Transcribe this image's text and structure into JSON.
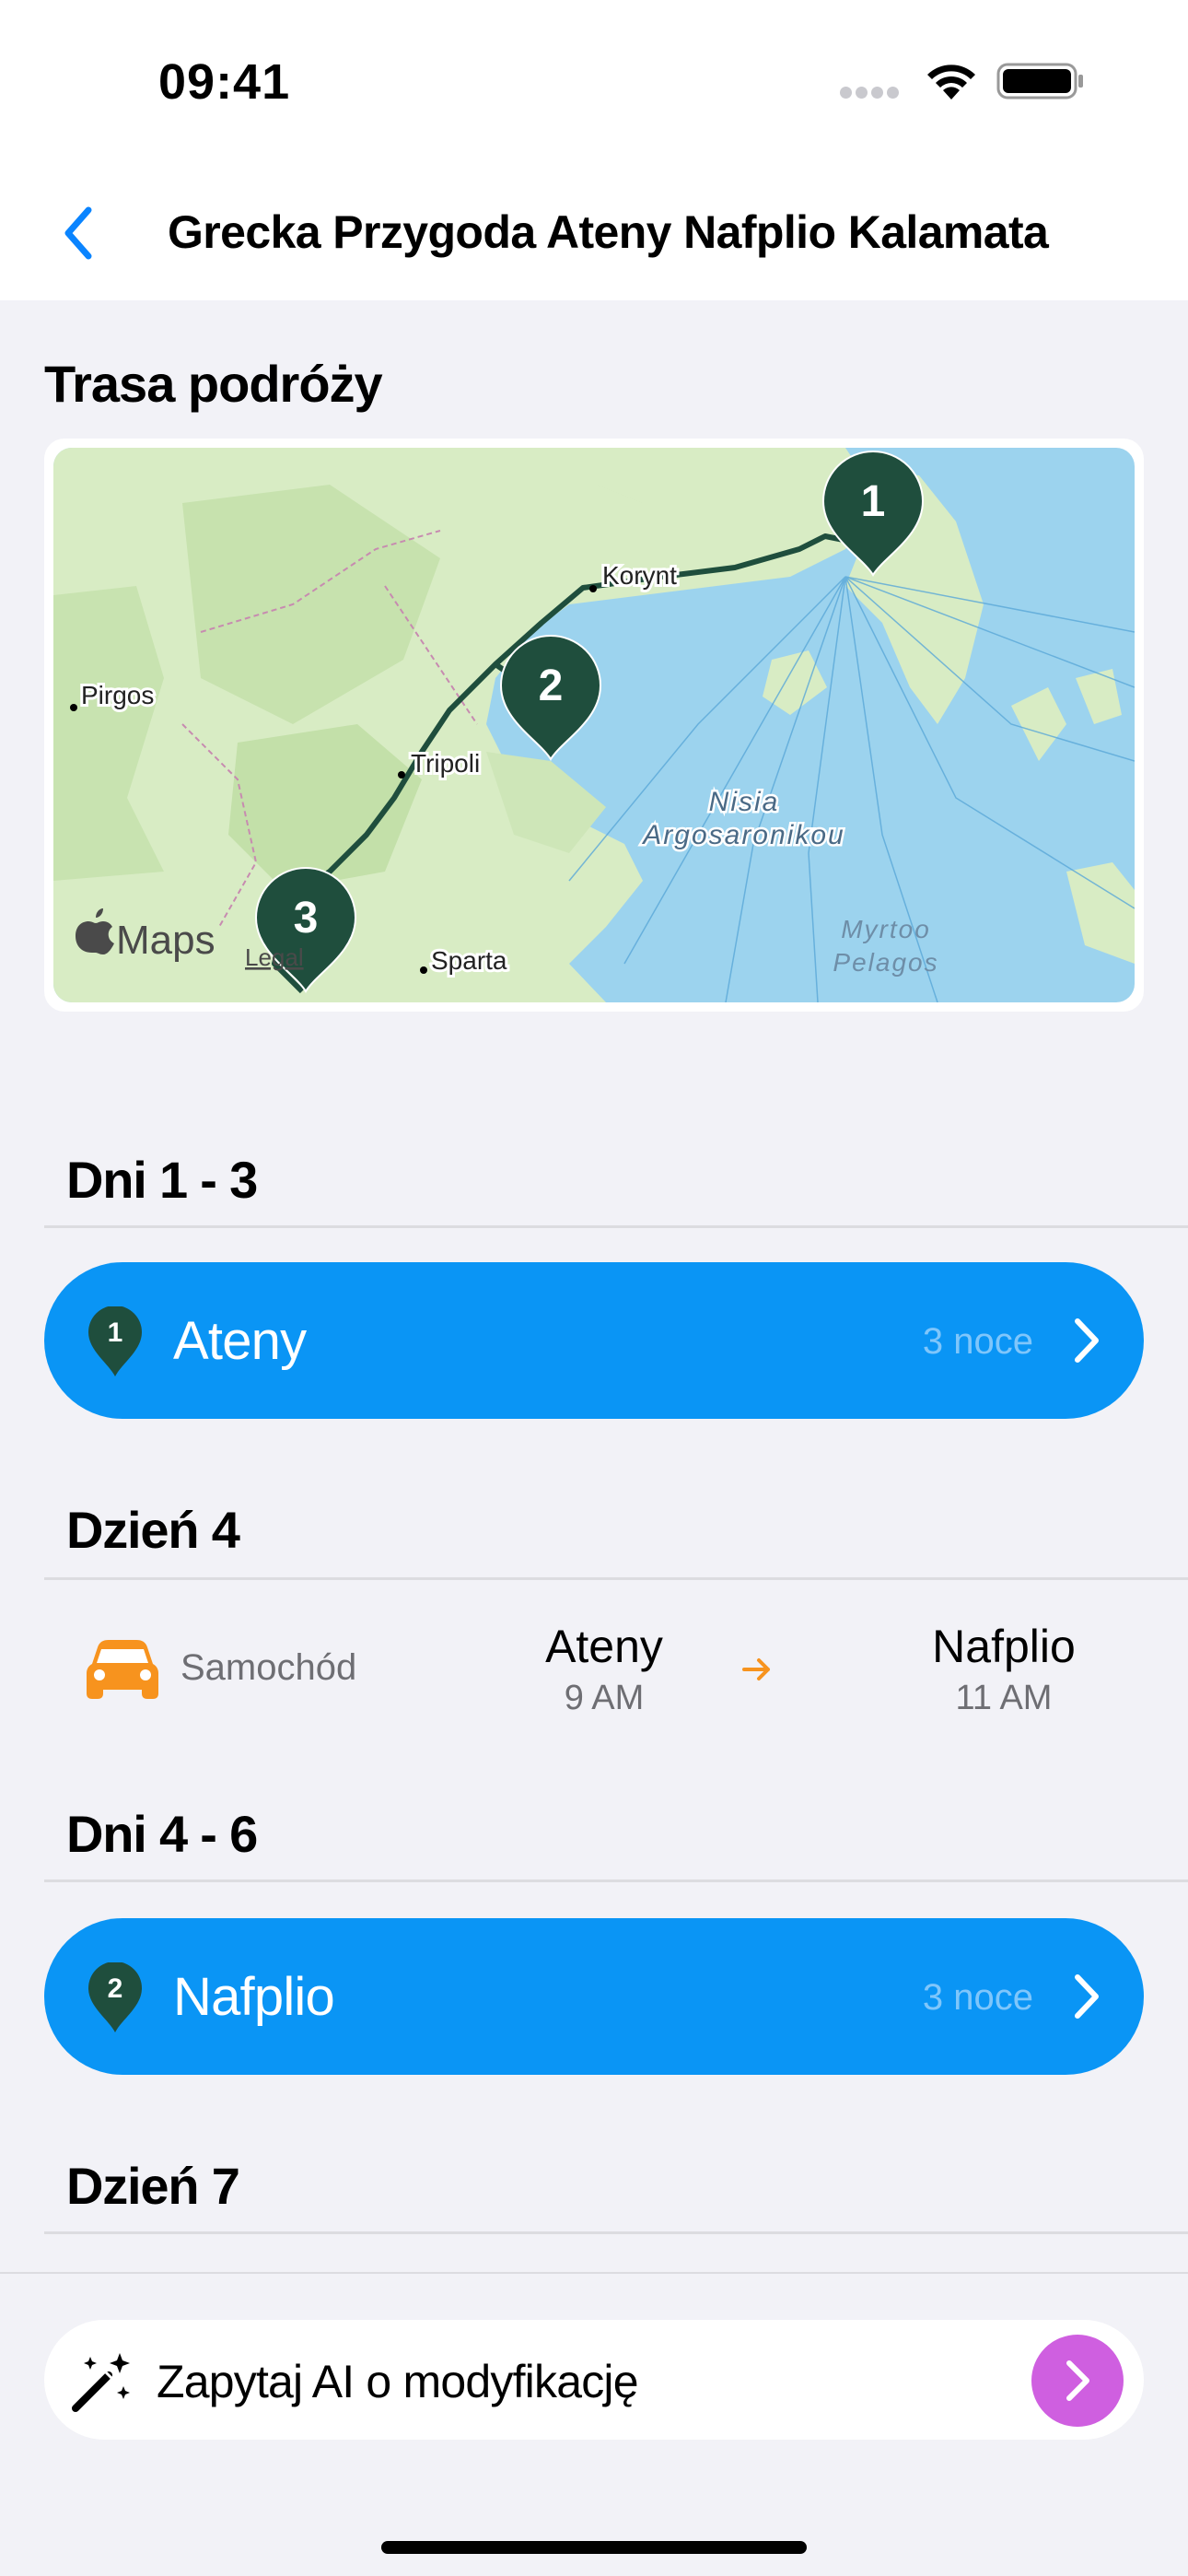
{
  "status_bar": {
    "time": "09:41"
  },
  "nav": {
    "title": "Grecka Przygoda Ateny Nafplio Kalamata"
  },
  "route": {
    "heading": "Trasa podróży",
    "map": {
      "labels": [
        "Korynt",
        "Pirgos",
        "Tripoli",
        "Sparta",
        "Nisia",
        "Argosaronikou",
        "Myrtoo",
        "Pelagos"
      ],
      "pins": [
        "1",
        "2",
        "3"
      ],
      "brand": "Maps",
      "legal": "Legal"
    }
  },
  "itinerary": [
    {
      "heading": "Dni 1 - 3"
    },
    {
      "stop_number": "1",
      "name": "Ateny",
      "nights": "3 noce"
    },
    {
      "heading": "Dzień 4"
    },
    {
      "mode": "Samochód",
      "from": "Ateny",
      "from_time": "9 AM",
      "to": "Nafplio",
      "to_time": "11 AM"
    },
    {
      "heading": "Dni 4 - 6"
    },
    {
      "stop_number": "2",
      "name": "Nafplio",
      "nights": "3 noce"
    },
    {
      "heading": "Dzień 7"
    }
  ],
  "ai_bar": {
    "label": "Zapytaj AI o modyfikację"
  },
  "colors": {
    "accent": "#0A95F5",
    "pin": "#1F4E3D",
    "car": "#F7931E",
    "ai_send": "#CF5FE0",
    "background": "#F2F2F7"
  },
  "icons": [
    "back-chevron-icon",
    "wifi-icon",
    "battery-icon",
    "map-pin-icon",
    "chevron-right-icon",
    "car-icon",
    "arrow-right-icon",
    "magic-wand-icon"
  ]
}
